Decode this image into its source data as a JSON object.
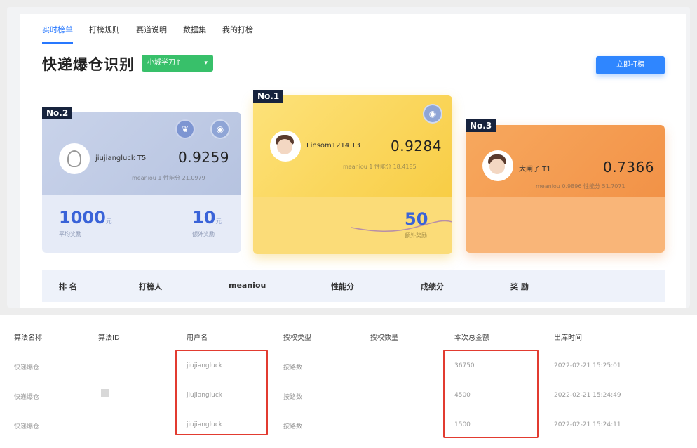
{
  "tabs": [
    "实时榜单",
    "打榜规则",
    "赛道说明",
    "数据集",
    "我的打榜"
  ],
  "page_title": "快递爆仓识别",
  "select_value": "小城学刀↑",
  "join_button": "立即打榜",
  "podium": {
    "second": {
      "rank": "No.2",
      "user": "jiujiangluck T5",
      "score": "0.9259",
      "meta": "meaniou 1  性能分 21.0979",
      "reward_amount": "1000",
      "reward_unit": "元",
      "reward_label": "平均奖励",
      "count_amount": "10",
      "count_unit": "元",
      "count_label": "额外奖励"
    },
    "first": {
      "rank": "No.1",
      "user": "Linsom1214 T3",
      "score": "0.9284",
      "meta": "meaniou 1  性能分 18.4185",
      "count_amount": "50",
      "count_label": "额外奖励"
    },
    "third": {
      "rank": "No.3",
      "user": "大闸了 T1",
      "score": "0.7366",
      "meta": "meaniou 0.9896  性能分 51.7071"
    }
  },
  "table_headers": [
    "排 名",
    "打榜人",
    "meaniou",
    "性能分",
    "成绩分",
    "奖 励"
  ],
  "sheet": {
    "headers": [
      "算法名称",
      "算法ID",
      "用户名",
      "授权类型",
      "授权数量",
      "本次总金额",
      "出库时间"
    ],
    "rows": [
      {
        "algo": "快递爆仓",
        "user": "jiujiangluck",
        "type": "按路数",
        "amount": "36750",
        "time": "2022-02-21 15:25:01"
      },
      {
        "algo": "快递爆仓",
        "user": "jiujiangluck",
        "type": "按路数",
        "amount": "4500",
        "time": "2022-02-21 15:24:49"
      },
      {
        "algo": "快递爆仓",
        "user": "jiujiangluck",
        "type": "按路数",
        "amount": "1500",
        "time": "2022-02-21 15:24:11"
      }
    ]
  },
  "colors": {
    "accent": "#2878ff",
    "green": "#38c06a",
    "navy_tag": "#17233d",
    "highlight_red": "#e23b30"
  }
}
